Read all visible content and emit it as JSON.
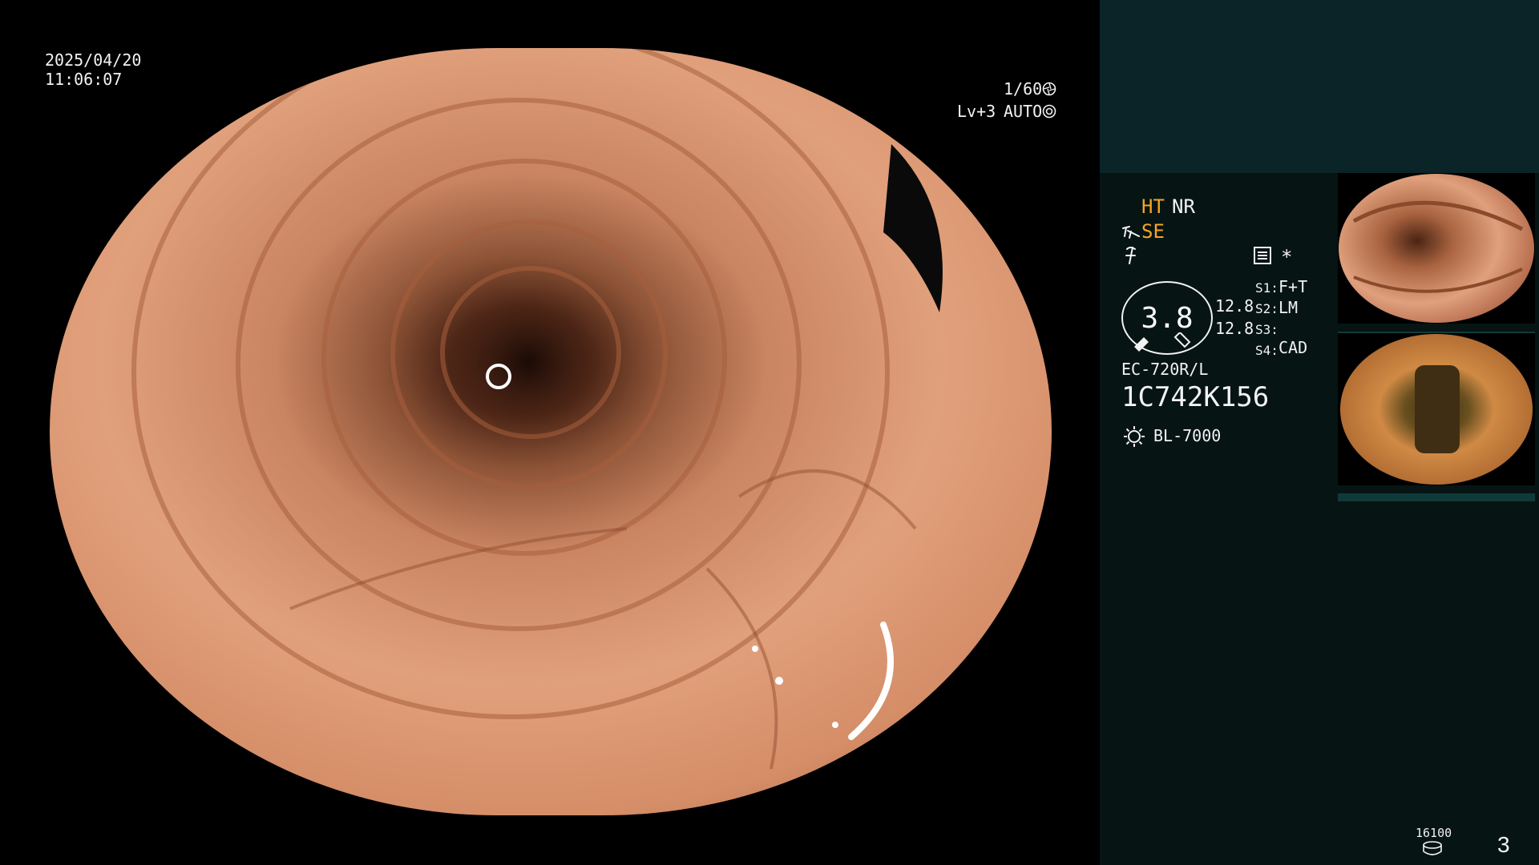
{
  "datetime": {
    "date": "2025/04/20",
    "time": "11:06:07"
  },
  "top_right": {
    "shutter": "1/60",
    "level": "Lv+3",
    "iris": "AUTO"
  },
  "settings": {
    "ht": "HT",
    "nr": "NR",
    "se": "SE",
    "s1_key": "S1:",
    "s1_val": "F+T",
    "s2_key": "S2:",
    "s2_val": "LM",
    "s3_key": "S3:",
    "s3_val": "",
    "s4_key": "S4:",
    "s4_val": "CAD",
    "asterisk": "*"
  },
  "zoom": {
    "value": "3.8",
    "upper": "12.8",
    "lower": "12.8"
  },
  "scope": {
    "model": "EC-720R/L",
    "serial": "1C742K156",
    "light_source": "BL-7000"
  },
  "footer": {
    "counter": "16100",
    "page": "3"
  },
  "colors": {
    "panel": "#071414",
    "panel_top": "#0b2427",
    "accent": "#f5a623",
    "mucosa": "#d99570"
  },
  "icons": [
    "shutter-icon",
    "iris-icon",
    "se-icon",
    "flash-icon",
    "memory-icon",
    "light-source-icon",
    "disk-icon"
  ]
}
